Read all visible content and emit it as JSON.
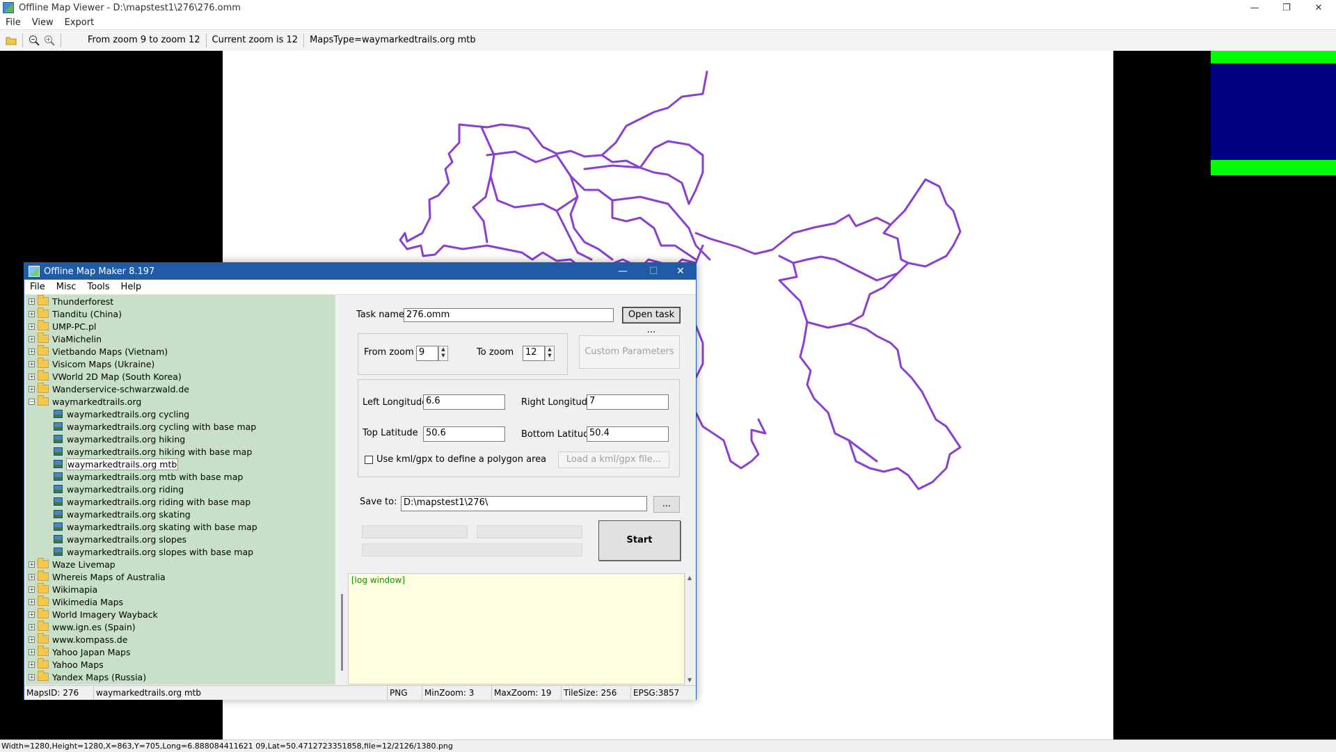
{
  "main_window": {
    "title": "Offline Map Viewer - D:\\mapstest1\\276\\276.omm",
    "menu": [
      "File",
      "View",
      "Export"
    ],
    "toolbar": {
      "zoom_range": "From zoom 9 to zoom 12",
      "current_zoom": "Current zoom is 12",
      "maps_type": "MapsType=waymarkedtrails.org mtb"
    },
    "controls": {
      "minimize": "—",
      "restore": "❐",
      "close": "✕"
    },
    "status_bar": "Width=1280,Height=1280,X=863,Y=705,Long=6.888084411621 09,Lat=50.4712723351858,file=12/2126/1380.png"
  },
  "dialog": {
    "title": "Offline Map Maker 8.197",
    "controls": {
      "minimize": "—",
      "maximize": "☐",
      "close": "✕"
    },
    "menu": [
      "File",
      "Misc",
      "Tools",
      "Help"
    ],
    "tree": [
      {
        "label": "Thunderforest",
        "type": "folder",
        "expander": "+"
      },
      {
        "label": "Tianditu (China)",
        "type": "folder",
        "expander": "+"
      },
      {
        "label": "UMP-PC.pl",
        "type": "folder",
        "expander": "+"
      },
      {
        "label": "ViaMichelin",
        "type": "folder",
        "expander": "+"
      },
      {
        "label": "Vietbando Maps (Vietnam)",
        "type": "folder",
        "expander": "+"
      },
      {
        "label": "Visicom Maps (Ukraine)",
        "type": "folder",
        "expander": "+"
      },
      {
        "label": "VWorld 2D Map (South Korea)",
        "type": "folder",
        "expander": "+"
      },
      {
        "label": "Wanderservice-schwarzwald.de",
        "type": "folder",
        "expander": "+"
      },
      {
        "label": "waymarkedtrails.org",
        "type": "folder",
        "expander": "−"
      },
      {
        "label": "waymarkedtrails.org cycling",
        "type": "map"
      },
      {
        "label": "waymarkedtrails.org cycling with base map",
        "type": "map"
      },
      {
        "label": "waymarkedtrails.org hiking",
        "type": "map"
      },
      {
        "label": "waymarkedtrails.org hiking with base map",
        "type": "map"
      },
      {
        "label": "waymarkedtrails.org mtb",
        "type": "map",
        "selected": true
      },
      {
        "label": "waymarkedtrails.org mtb with base map",
        "type": "map"
      },
      {
        "label": "waymarkedtrails.org riding",
        "type": "map"
      },
      {
        "label": "waymarkedtrails.org riding with base map",
        "type": "map"
      },
      {
        "label": "waymarkedtrails.org skating",
        "type": "map"
      },
      {
        "label": "waymarkedtrails.org skating with base map",
        "type": "map"
      },
      {
        "label": "waymarkedtrails.org slopes",
        "type": "map"
      },
      {
        "label": "waymarkedtrails.org slopes with base map",
        "type": "map"
      },
      {
        "label": "Waze Livemap",
        "type": "folder",
        "expander": "+"
      },
      {
        "label": "Whereis Maps of Australia",
        "type": "folder",
        "expander": "+"
      },
      {
        "label": "Wikimapia",
        "type": "folder",
        "expander": "+"
      },
      {
        "label": "Wikimedia Maps",
        "type": "folder",
        "expander": "+"
      },
      {
        "label": "World Imagery Wayback",
        "type": "folder",
        "expander": "+"
      },
      {
        "label": "www.ign.es (Spain)",
        "type": "folder",
        "expander": "+"
      },
      {
        "label": "www.kompass.de",
        "type": "folder",
        "expander": "+"
      },
      {
        "label": "Yahoo Japan Maps",
        "type": "folder",
        "expander": "+"
      },
      {
        "label": "Yahoo Maps",
        "type": "folder",
        "expander": "+"
      },
      {
        "label": "Yandex Maps (Russia)",
        "type": "folder",
        "expander": "+"
      }
    ],
    "form": {
      "task_name_label": "Task name",
      "task_name_value": "276.omm",
      "open_task_button": "Open task ...",
      "from_zoom_label": "From zoom",
      "from_zoom_value": "9",
      "to_zoom_label": "To zoom",
      "to_zoom_value": "12",
      "custom_params_button": "Custom Parameters",
      "left_lon_label": "Left Longitude",
      "left_lon_value": "6.6",
      "right_lon_label": "Right Longitude",
      "right_lon_value": "7",
      "top_lat_label": "Top Latitude",
      "top_lat_value": "50.6",
      "bottom_lat_label": "Bottom Latitude",
      "bottom_lat_value": "50.4",
      "kml_checkbox_label": "Use kml/gpx to define a polygon area",
      "load_kml_button": "Load a kml/gpx file...",
      "save_to_label": "Save to:",
      "save_to_value": "D:\\mapstest1\\276\\",
      "browse_button": "...",
      "start_button": "Start"
    },
    "log_text": "[log window]",
    "status": {
      "maps_id": "MapsID: 276",
      "maps_name": "waymarkedtrails.org mtb",
      "format": "PNG",
      "min_zoom": "MinZoom: 3",
      "max_zoom": "MaxZoom: 19",
      "tile_size": "TileSize: 256",
      "epsg": "EPSG:3857"
    }
  },
  "colors": {
    "trail_line": "#8a3fd1",
    "tree_bg": "#c8e0c8",
    "log_bg": "#ffffe0",
    "dialog_title_bg": "#1f5ba6"
  }
}
